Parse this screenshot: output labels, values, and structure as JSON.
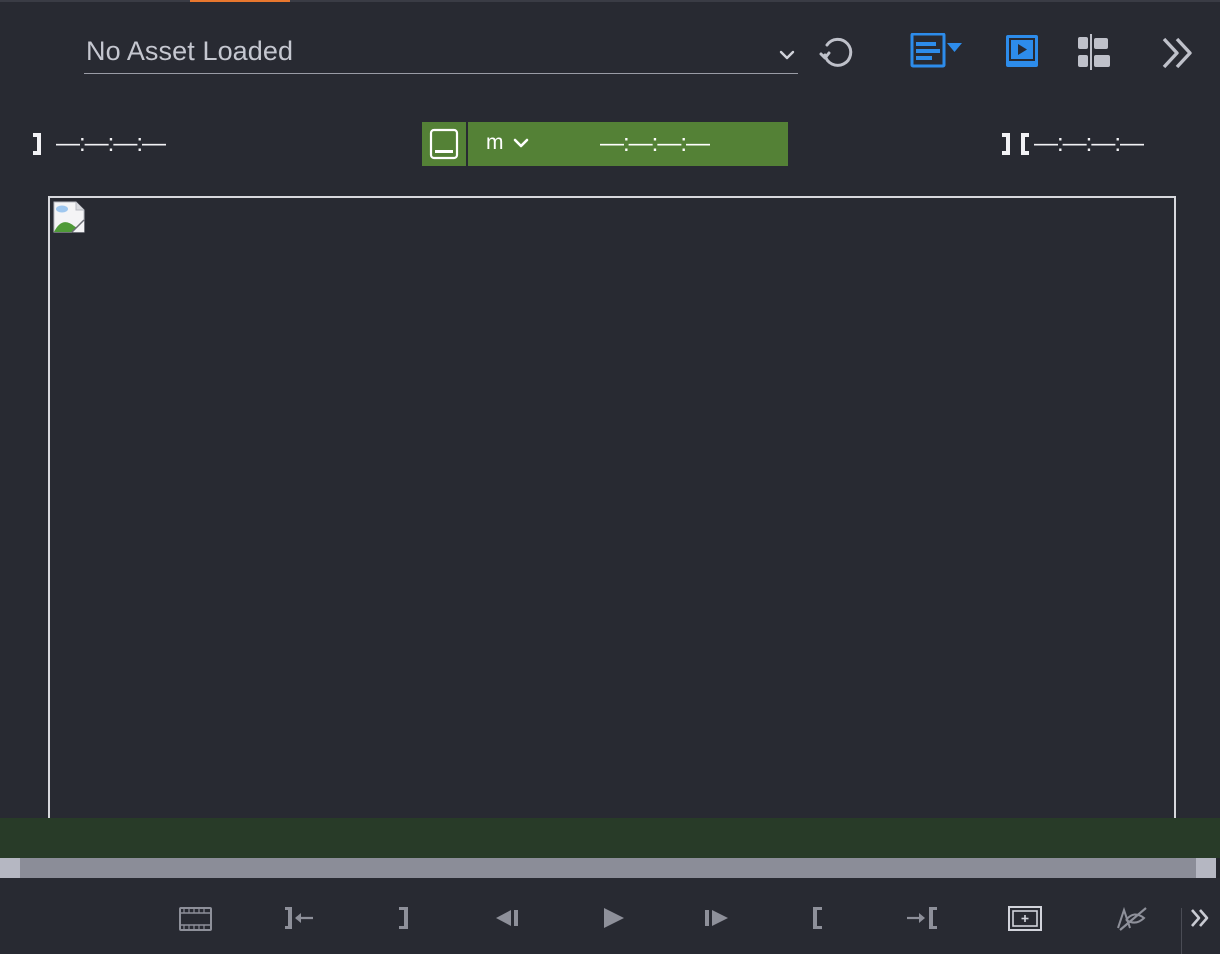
{
  "window": {
    "accent_color": "#e8772e",
    "bg_color": "#282a32"
  },
  "asset_selector": {
    "value": "No Asset Loaded",
    "icon": "chevron-down-icon"
  },
  "toolbar": {
    "icons": [
      "refresh-icon",
      "layout-dropdown-icon",
      "player-icon",
      "align-panel-icon",
      "more-chevrons-icon"
    ],
    "active_color": "#2d8ceb"
  },
  "timecode": {
    "in_point": "—:—:—:—",
    "out_point": "—:—:—:—",
    "current": "—:—:—:—",
    "mode": "m",
    "center_bg": "#548136"
  },
  "viewer": {
    "image_icon": "broken-image-icon"
  },
  "transport": {
    "buttons": [
      "filmstrip-icon",
      "go-to-out-icon",
      "mark-out-icon",
      "step-back-icon",
      "play-icon",
      "step-forward-icon",
      "mark-in-icon",
      "go-to-in-icon",
      "safe-area-icon",
      "hide-overlays-icon",
      "more-icon"
    ],
    "icon_color": "#8e909a"
  }
}
